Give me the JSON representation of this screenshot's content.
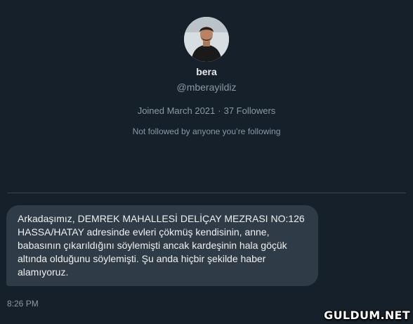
{
  "profile": {
    "display_name": "bera",
    "handle": "@mberayildiz",
    "joined": "Joined March 2021",
    "separator": "·",
    "followers": "37 Followers",
    "relation": "Not followed by anyone you’re following"
  },
  "message": {
    "text": "Arkadaşımız, DEMREK MAHALLESİ DELİÇAY MEZRASI NO:126 HASSA/HATAY adresinde evleri çökmüş kendisinin, anne, babasının çıkarıldığını söylemişti ancak kardeşinin hala göçük altında olduğunu söylemişti. Şu anda hiçbir şekilde haber alamıyoruz.",
    "timestamp": "8:26 PM"
  },
  "watermark": "GULDUM.NET",
  "colors": {
    "background": "#15202b",
    "bubble": "#2f3b47",
    "secondary_text": "#8b98a5",
    "divider": "#38444d"
  }
}
